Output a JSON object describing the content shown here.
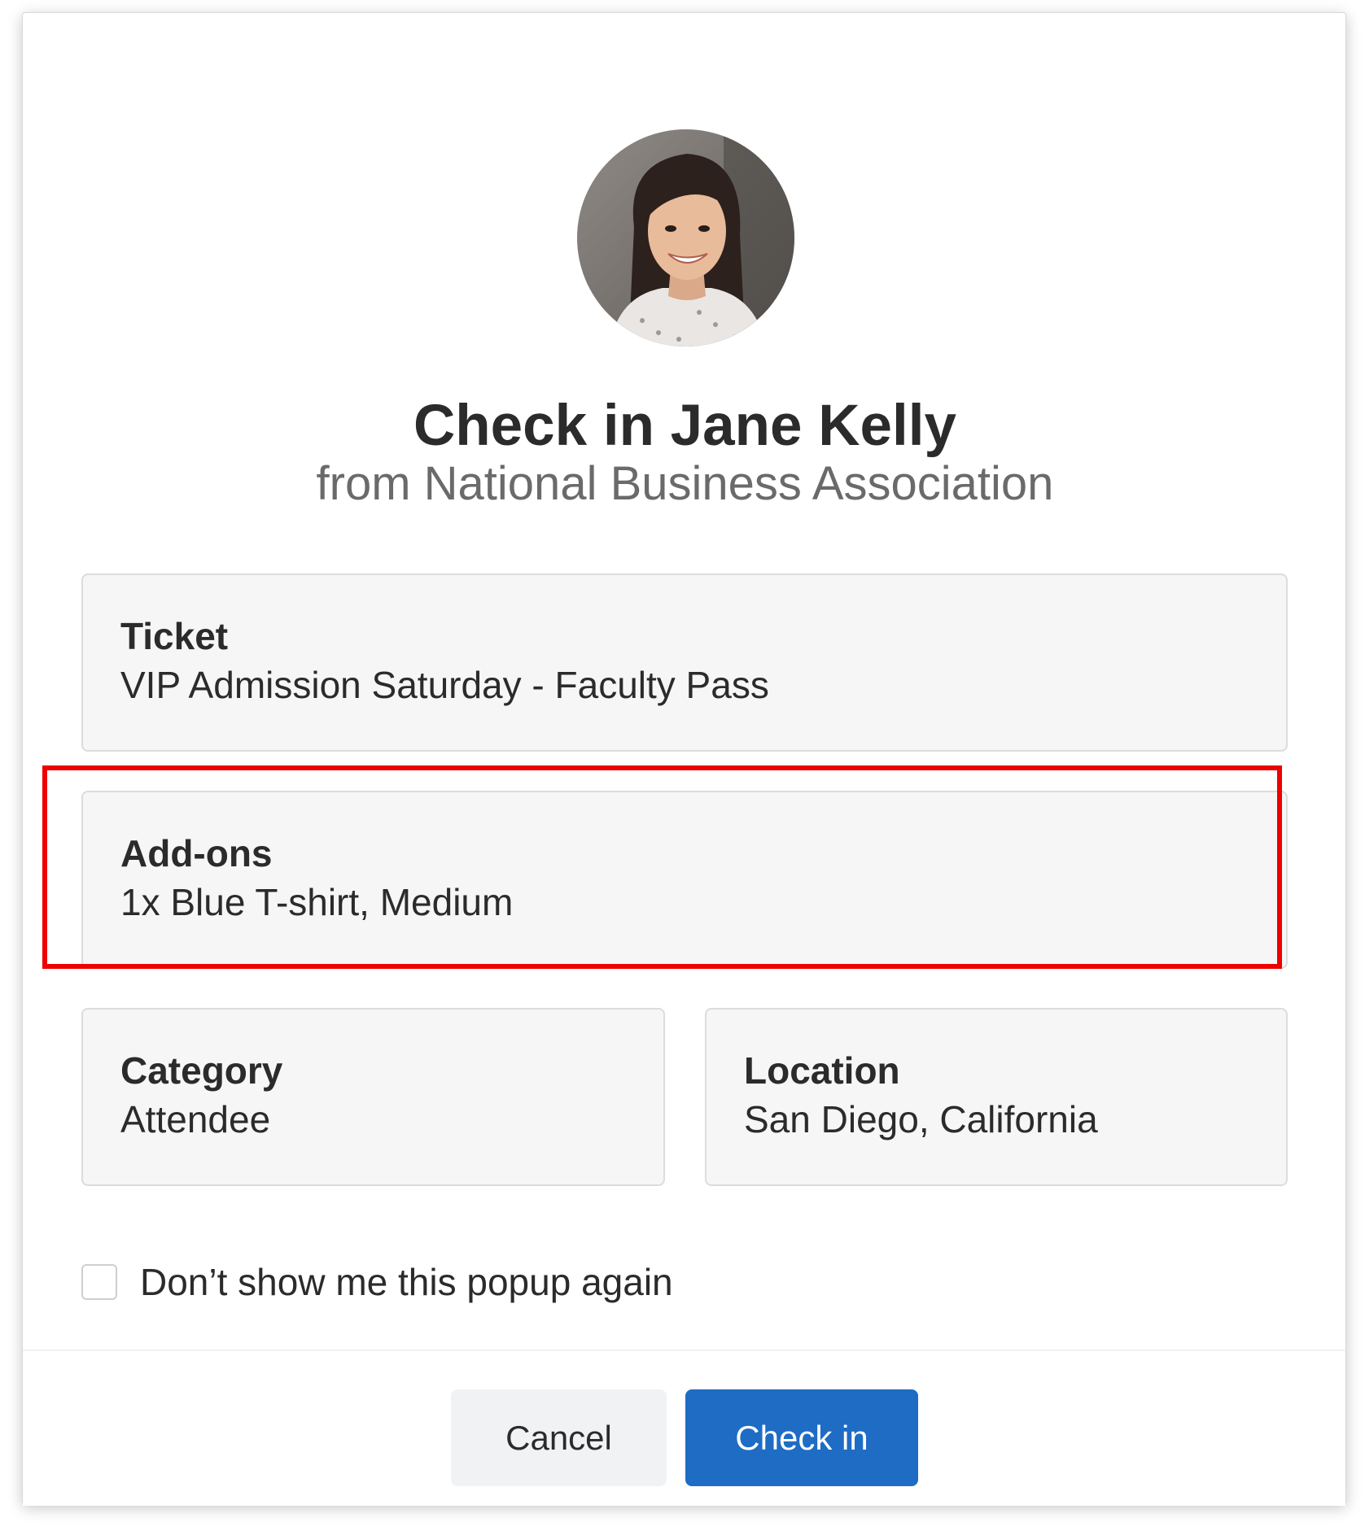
{
  "dialog": {
    "title": "Check in Jane Kelly",
    "subtitle": "from National Business Association"
  },
  "cards": {
    "ticket": {
      "label": "Ticket",
      "value": "VIP Admission Saturday - Faculty Pass"
    },
    "addons": {
      "label": "Add-ons",
      "value": "1x Blue T-shirt, Medium"
    },
    "category": {
      "label": "Category",
      "value": "Attendee"
    },
    "location": {
      "label": "Location",
      "value": "San Diego, California"
    }
  },
  "dont_show": {
    "label": "Don’t show me this popup again",
    "checked": false
  },
  "buttons": {
    "cancel": "Cancel",
    "check_in": "Check in"
  },
  "colors": {
    "primary": "#1e6cc4",
    "highlight": "#ee0000",
    "card_bg": "#f6f6f6",
    "text": "#2b2b2b",
    "muted": "#6a6a6a"
  }
}
